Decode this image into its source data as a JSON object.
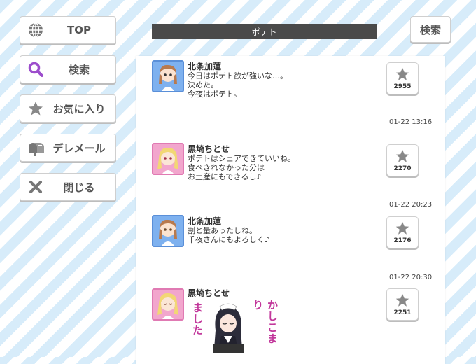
{
  "nav": {
    "top": "TOP",
    "search": "検索",
    "favorites": "お気に入り",
    "deremail": "デレメール",
    "close": "閉じる"
  },
  "header": {
    "search_button": "検索",
    "title": "ポテト"
  },
  "messages": [
    {
      "sender": "北条加蓮",
      "lines": [
        "今日はポテト欲が強いな…。",
        "決めた。",
        "今夜はポテト。"
      ],
      "likes": "2955",
      "timestamp": "01-22 13:16"
    },
    {
      "sender": "黒埼ちとせ",
      "lines": [
        "ポテトはシェアできていいね。",
        "食べきれなかった分は",
        "お土産にもできるし♪"
      ],
      "likes": "2270",
      "timestamp": "01-22 20:23"
    },
    {
      "sender": "北条加蓮",
      "lines": [
        "割と量あったしね。",
        "千夜さんにもよろしく♪"
      ],
      "likes": "2176",
      "timestamp": "01-22 20:30"
    },
    {
      "sender": "黒埼ちとせ",
      "stamp_text_right": "かしこまり",
      "stamp_text_left": "ました",
      "likes": "2251"
    }
  ]
}
